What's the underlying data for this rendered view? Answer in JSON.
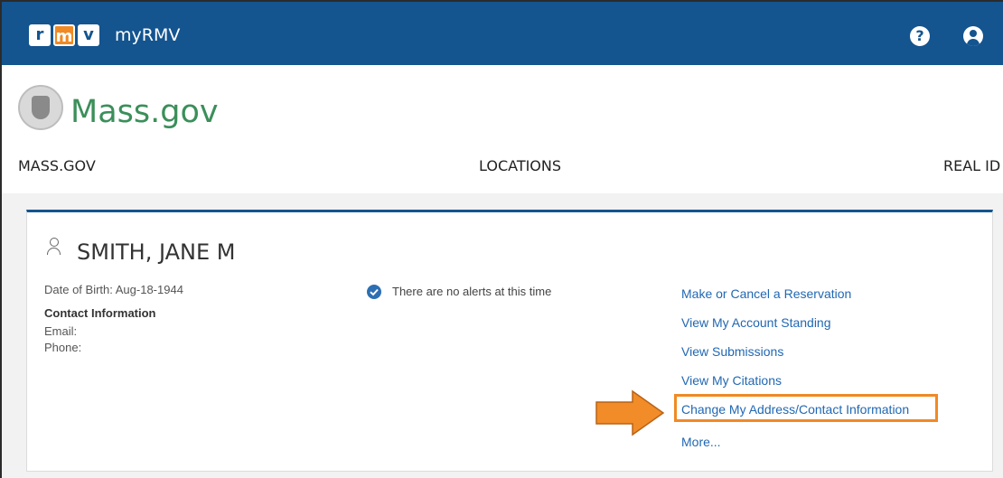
{
  "topbar": {
    "logo_letters": [
      "r",
      "m",
      "v"
    ],
    "app_title": "myRMV",
    "help_label": "?",
    "help_icon": "help-circle-icon",
    "account_icon": "user-circle-icon",
    "color": "#14548f"
  },
  "header": {
    "brand": "Mass.gov",
    "brand_color": "#3b8f5a",
    "nav": {
      "massgov": "MASS.GOV",
      "locations": "LOCATIONS",
      "realid": "REAL ID"
    }
  },
  "profile": {
    "name": "SMITH, JANE M",
    "dob": "Date of Birth: Aug-18-1944",
    "contact_heading": "Contact Information",
    "email_label": "Email:",
    "phone_label": "Phone:",
    "alerts": "There are no alerts at this time"
  },
  "links": {
    "reservation": "Make or Cancel a Reservation",
    "account_standing": "View My Account Standing",
    "submissions": "View Submissions",
    "citations": "View My Citations",
    "change_address": "Change My Address/Contact Information",
    "more": "More..."
  },
  "callout": {
    "color": "#f08a24",
    "highlighted": "change_address"
  }
}
